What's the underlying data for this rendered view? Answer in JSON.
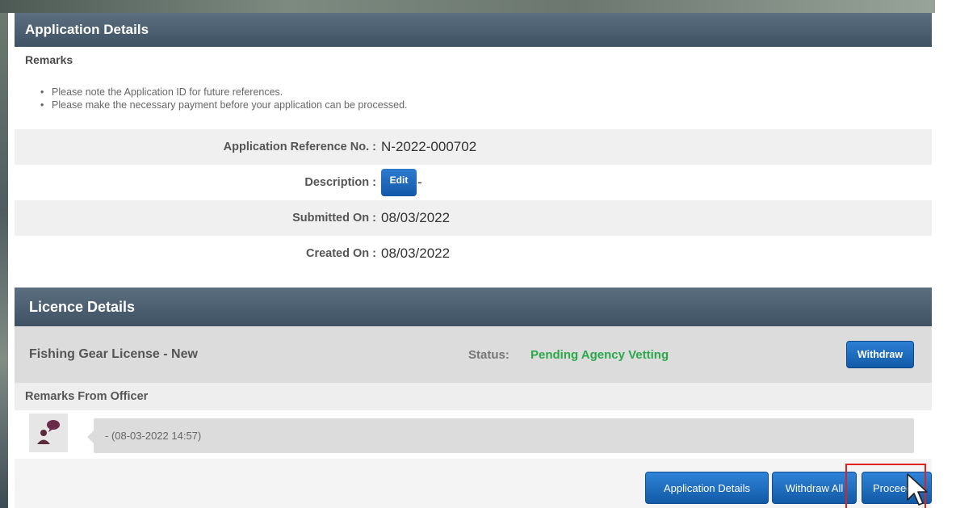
{
  "application_details": {
    "header": "Application Details",
    "remarks_title": "Remarks",
    "notes": [
      "Please note the Application ID for future references.",
      "Please make the necessary payment before your application can be processed."
    ],
    "fields": {
      "reference_label": "Application Reference No. :",
      "reference_value": "N-2022-000702",
      "description_label": "Description :",
      "description_edit": "Edit",
      "description_value": "-",
      "submitted_label": "Submitted On :",
      "submitted_value": "08/03/2022",
      "created_label": "Created On :",
      "created_value": "08/03/2022"
    }
  },
  "licence_details": {
    "header": "Licence Details",
    "licence_name": "Fishing Gear License - New",
    "status_label": "Status:",
    "status_value": "Pending Agency Vetting",
    "status_color": "#2aa84a",
    "withdraw_label": "Withdraw",
    "officer_title": "Remarks From Officer",
    "officer_avatar_icon": "person-speech-icon",
    "comment": "- (08-03-2022 14:57)"
  },
  "footer": {
    "application_details_label": "Application Details",
    "withdraw_all_label": "Withdraw All",
    "proceed_label": "Proceed"
  },
  "colors": {
    "header_bg": "#4a5d6e",
    "button_blue": "#1e6cc0",
    "highlight_red": "#e0231f"
  }
}
